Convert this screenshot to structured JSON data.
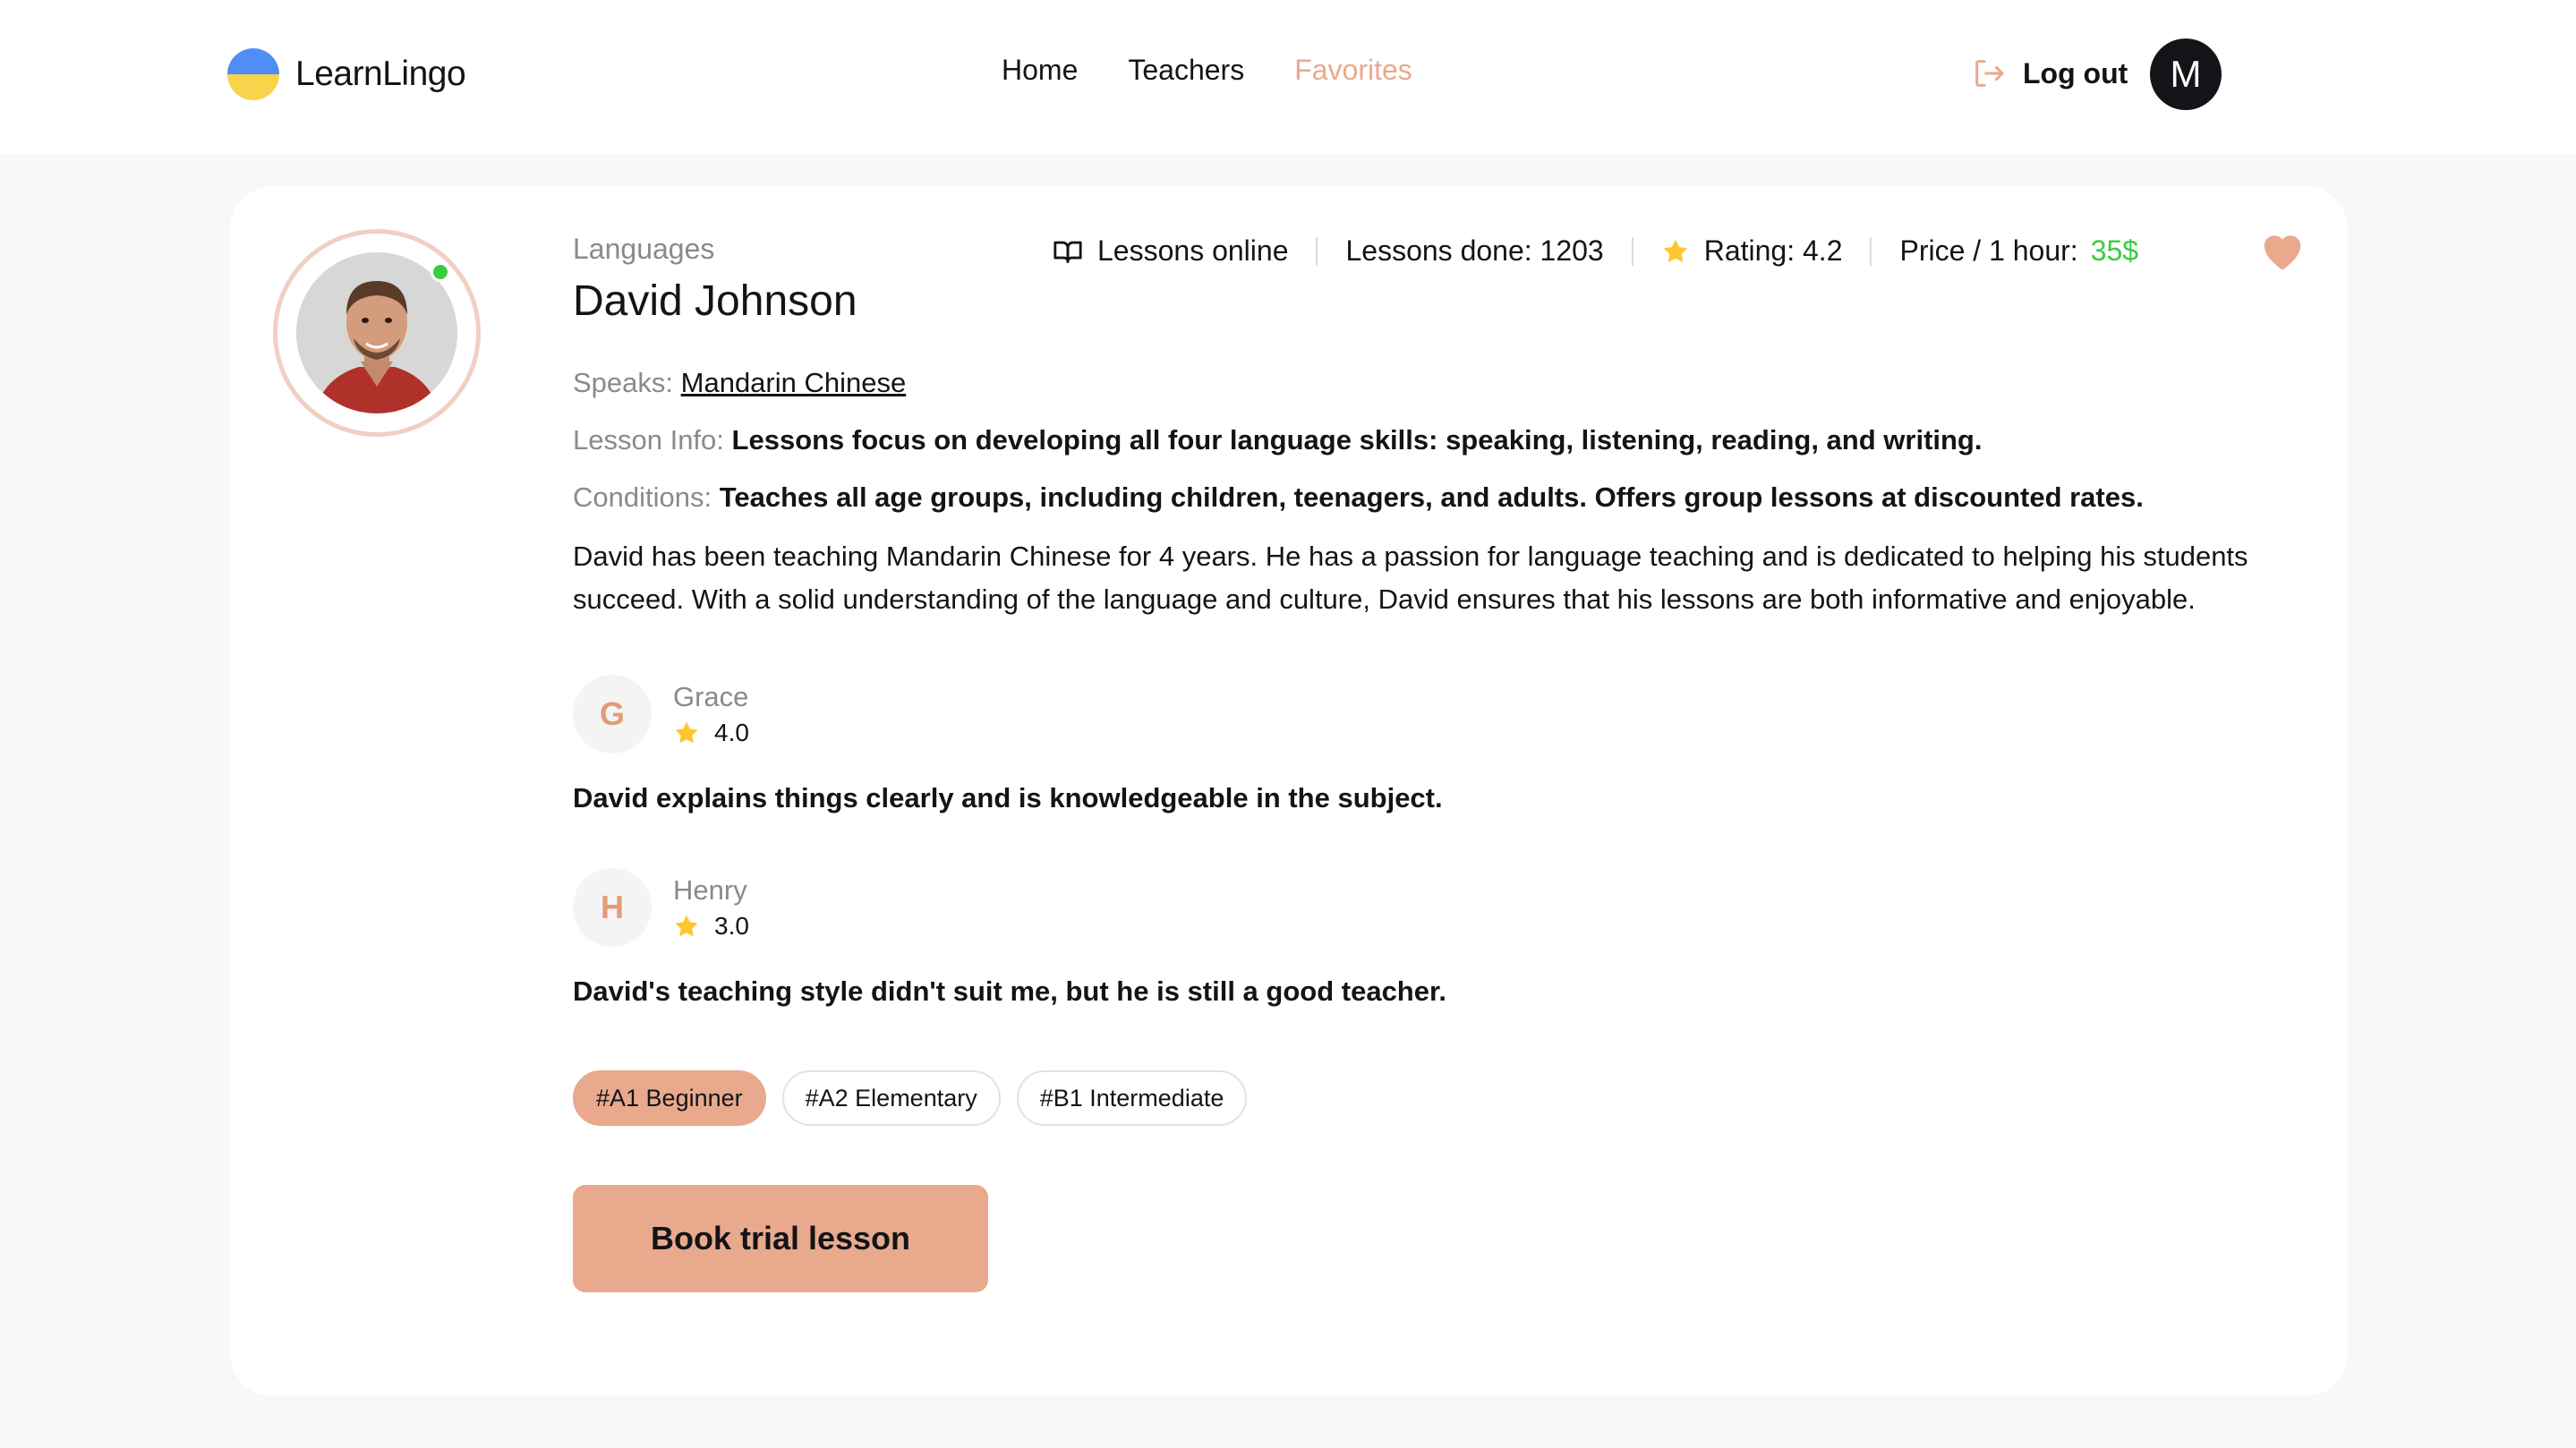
{
  "header": {
    "logo_text": "LearnLingo",
    "nav": [
      {
        "label": "Home",
        "active": false
      },
      {
        "label": "Teachers",
        "active": false
      },
      {
        "label": "Favorites",
        "active": true
      }
    ],
    "logout_label": "Log out",
    "user_initial": "M"
  },
  "teacher": {
    "category": "Languages",
    "name": "David Johnson",
    "lessons_online": "Lessons online",
    "lessons_done": "Lessons done: 1203",
    "rating": "Rating: 4.2",
    "price_label": "Price / 1 hour:",
    "price_value": "35$",
    "favorited": true,
    "speaks_label": "Speaks:",
    "speaks_value": "Mandarin Chinese",
    "lesson_info_label": "Lesson Info:",
    "lesson_info_value": "Lessons focus on developing all four language skills: speaking, listening, reading, and writing.",
    "conditions_label": "Conditions:",
    "conditions_value": "Teaches all age groups, including children, teenagers, and adults. Offers group lessons at discounted rates.",
    "bio": "David has been teaching Mandarin Chinese for 4 years. He has a passion for language teaching and is dedicated to helping his students succeed. With a solid understanding of the language and culture, David ensures that his lessons are both informative and enjoyable."
  },
  "reviews": [
    {
      "initial": "G",
      "name": "Grace",
      "rating": "4.0",
      "text": "David explains things clearly and is knowledgeable in the subject."
    },
    {
      "initial": "H",
      "name": "Henry",
      "rating": "3.0",
      "text": "David's teaching style didn't suit me, but he is still a good teacher."
    }
  ],
  "levels": [
    "#A1 Beginner",
    "#A2 Elementary",
    "#B1 Intermediate"
  ],
  "book_button_label": "Book trial lesson",
  "colors": {
    "accent": "#e9a98d",
    "online": "#38cd3e",
    "star": "#ffc531",
    "text": "#121417",
    "muted": "#8a8a89"
  }
}
